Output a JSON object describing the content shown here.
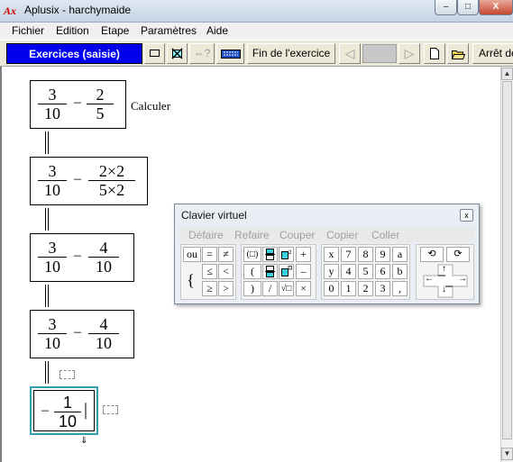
{
  "window": {
    "title": "Aplusix - harchymaide",
    "app_icon_text": "Ax",
    "minimize_symbol": "–",
    "maximize_symbol": "□",
    "close_symbol": "X"
  },
  "menu": {
    "items": [
      "Fichier",
      "Edition",
      "Etape",
      "Paramètres",
      "Aide"
    ]
  },
  "toolbar": {
    "mode_label": "Exercices (saisie)",
    "end_exercise_label": "Fin de l'exercice",
    "stop_label": "Arrêt de",
    "help_icon_text": "⇔?",
    "prev_arrow": "◁",
    "next_arrow": "▷",
    "progress_fraction": 0
  },
  "steps": [
    {
      "left_num": "3",
      "left_den": "10",
      "op": "–",
      "right_num": "2",
      "right_den": "5",
      "label": "Calculer"
    },
    {
      "left_num": "3",
      "left_den": "10",
      "op": "–",
      "right_num": "2×2",
      "right_den": "5×2"
    },
    {
      "left_num": "3",
      "left_den": "10",
      "op": "–",
      "right_num": "4",
      "right_den": "10"
    },
    {
      "left_num": "3",
      "left_den": "10",
      "op": "–",
      "right_num": "4",
      "right_den": "10"
    },
    {
      "prefix": "–",
      "right_num": "1",
      "right_den": "10",
      "cursor": "|"
    }
  ],
  "keyboard": {
    "title": "Clavier virtuel",
    "close_symbol": "x",
    "menu": [
      "Défaire",
      "Refaire",
      "Couper",
      "Copier",
      "Coller"
    ],
    "relations": [
      "ou",
      "=",
      "≠",
      "≤",
      "<",
      "≥",
      ">"
    ],
    "brace": "{",
    "ops": [
      "(□)",
      "+",
      "(",
      "–",
      ")",
      "/",
      "√□",
      "×"
    ],
    "digits_row1": [
      "x",
      "7",
      "8",
      "9",
      "a"
    ],
    "digits_row2": [
      "y",
      "4",
      "5",
      "6",
      "b"
    ],
    "digits_row3": [
      "0",
      "1",
      "2",
      "3",
      ","
    ],
    "nav": [
      "⟲",
      "⟳",
      "↑",
      "←",
      "→",
      "↓"
    ]
  },
  "scrollbar": {
    "up": "▲",
    "down": "▼"
  },
  "status": {
    "wait_icon": "⇓"
  }
}
